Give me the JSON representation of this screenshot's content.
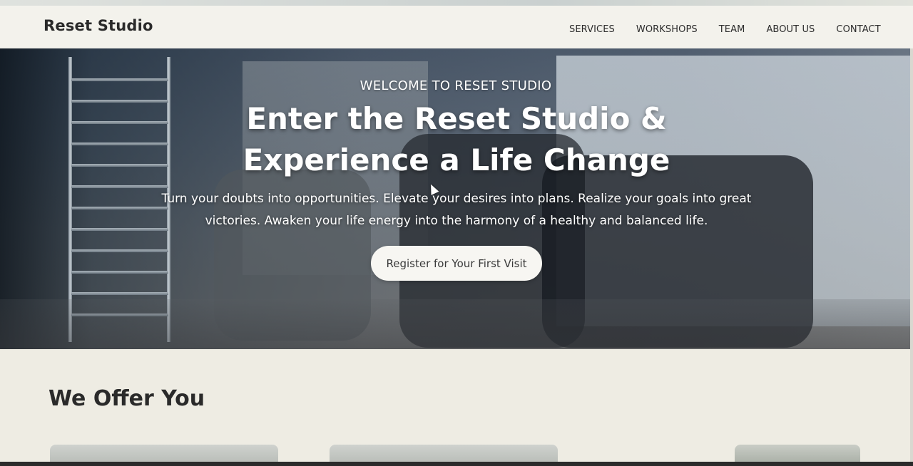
{
  "brand": {
    "name": "Reset Studio"
  },
  "nav": {
    "items": [
      "SERVICES",
      "WORKSHOPS",
      "TEAM",
      "ABOUT US",
      "CONTACT"
    ]
  },
  "hero": {
    "eyebrow": "WELCOME TO RESET STUDIO",
    "title": "Enter the Reset Studio & Experience a Life Change",
    "subtitle": "Turn your doubts into opportunities. Elevate your desires into plans. Realize your goals into great victories. Awaken your life energy into the harmony of a healthy and balanced life.",
    "cta_label": "Register for Your First Visit"
  },
  "offer": {
    "title": "We Offer You"
  },
  "colors": {
    "header_bg": "#f3f2ec",
    "page_bg": "#eeece3",
    "text_dark": "#2a2a2a",
    "cta_bg": "#f7f6f2"
  }
}
